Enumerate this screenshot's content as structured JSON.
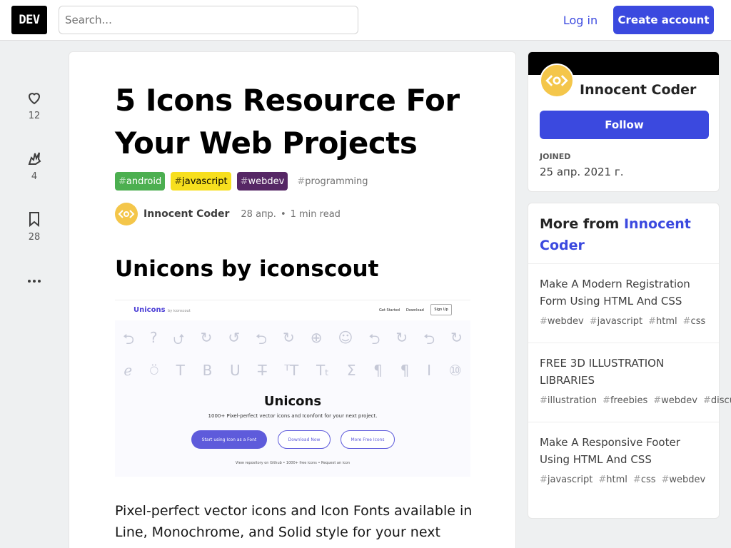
{
  "header": {
    "logo": "DEV",
    "search_placeholder": "Search...",
    "login": "Log in",
    "create_account": "Create account"
  },
  "reactions": [
    {
      "icon": "heart-icon",
      "count": "12"
    },
    {
      "icon": "unicorn-icon",
      "count": "4"
    },
    {
      "icon": "bookmark-icon",
      "count": "28"
    }
  ],
  "article": {
    "title": "5 Icons Resource For Your Web Projects",
    "tags": [
      {
        "label": "android",
        "bg": "#4caf50",
        "fg": "#ffffff"
      },
      {
        "label": "javascript",
        "bg": "#f7df1e",
        "fg": "#000000"
      },
      {
        "label": "webdev",
        "bg": "#562765",
        "fg": "#ffffff"
      },
      {
        "label": "programming",
        "bg": "#ffffff",
        "fg": "#717171"
      }
    ],
    "author": "Innocent Coder",
    "date": "28 апр.",
    "read_time": "1 min read",
    "section_heading": "Unicons by iconscout",
    "paragraph": "Pixel-perfect vector icons and Icon Fonts available in Line, Monochrome, and Solid style for your next project."
  },
  "preview": {
    "brand": "Unicons",
    "brand_by": "by iconscout",
    "nav": [
      "Get Started",
      "Download",
      "Sign Up"
    ],
    "title": "Unicons",
    "subtitle": "1000+ Pixel-perfect vector icons and Iconfont for your next project.",
    "buttons": [
      "Start using Icon as a Font",
      "Download Now",
      "More Free Icons"
    ],
    "footer": "View repository on Github  •  1000+ free icons  •  Request an icon",
    "row1": [
      "⮌",
      "?",
      "⮍",
      "↻",
      "↺",
      "⮌",
      "↻",
      "⊕",
      "☺",
      "⮌",
      "↻",
      "⮌",
      "↻"
    ],
    "row2": [
      "ℯ",
      "⍥",
      "T",
      "B",
      "U",
      "T̶",
      "ᵀT",
      "Tₜ",
      "Σ",
      "¶",
      "¶",
      "I",
      "⑩"
    ]
  },
  "sidebar": {
    "author": "Innocent Coder",
    "follow": "Follow",
    "joined_label": "JOINED",
    "joined_date": "25 апр. 2021 г.",
    "more_prefix": "More from ",
    "more_author": "Innocent Coder",
    "items": [
      {
        "title": "Make A Modern Registration Form Using HTML And CSS",
        "tags": [
          "webdev",
          "javascript",
          "html",
          "css"
        ]
      },
      {
        "title": "FREE 3D ILLUSTRATION LIBRARIES",
        "tags": [
          "illustration",
          "freebies",
          "webdev",
          "discuss"
        ]
      },
      {
        "title": "Make A Responsive Footer Using HTML And CSS",
        "tags": [
          "javascript",
          "html",
          "css",
          "webdev"
        ]
      }
    ]
  },
  "colors": {
    "accent": "#3b49df",
    "avatar": "#f4c64a"
  }
}
